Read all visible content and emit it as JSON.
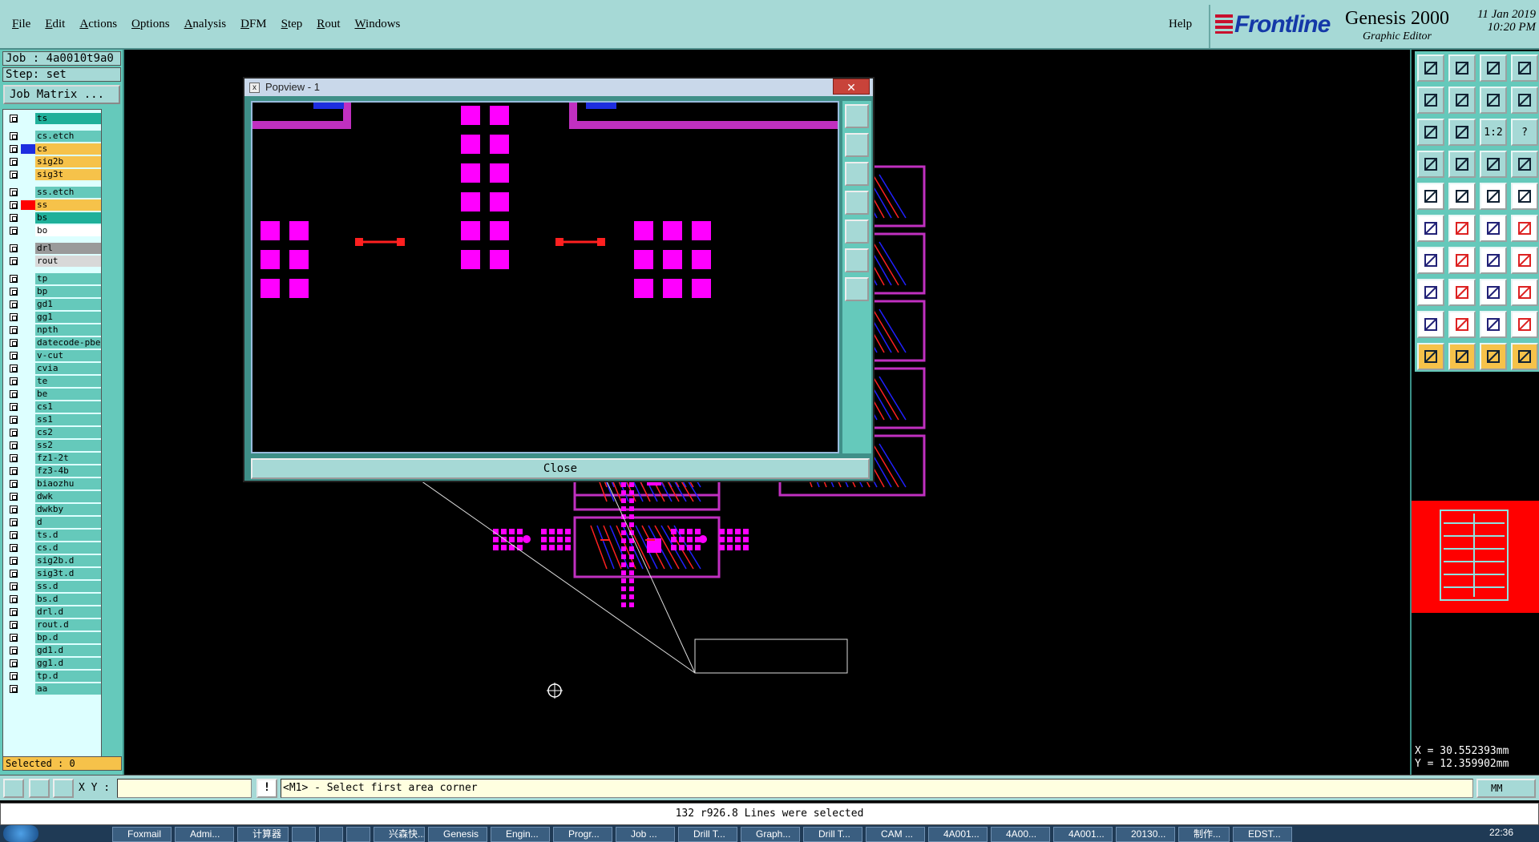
{
  "menubar": {
    "items": [
      "File",
      "Edit",
      "Actions",
      "Options",
      "Analysis",
      "DFM",
      "Step",
      "Rout",
      "Windows"
    ],
    "help": "Help",
    "brand": "Frontline",
    "product": "Genesis 2000",
    "subtitle": "Graphic Editor",
    "date": "11 Jan 2019",
    "time": "10:20 PM"
  },
  "left": {
    "job": "Job : 4a0010t9a0",
    "step": "Step: set",
    "matrix_button": "Job Matrix ...",
    "selected": "Selected : 0",
    "layers": [
      {
        "name": "ts",
        "color": "#1fb09a",
        "swatch": ""
      },
      {
        "name": "cs.etch",
        "color": "#65c9bb",
        "swatch": ""
      },
      {
        "name": "cs",
        "color": "#f6c24a",
        "swatch": "#1e2ee0"
      },
      {
        "name": "sig2b",
        "color": "#f6c24a",
        "swatch": ""
      },
      {
        "name": "sig3t",
        "color": "#f6c24a",
        "swatch": ""
      },
      {
        "name": "ss.etch",
        "color": "#65c9bb",
        "swatch": ""
      },
      {
        "name": "ss",
        "color": "#f6c24a",
        "swatch": "#ff0000"
      },
      {
        "name": "bs",
        "color": "#1fb09a",
        "swatch": ""
      },
      {
        "name": "bo",
        "color": "#ffffff",
        "swatch": ""
      },
      {
        "name": "drl",
        "color": "#9a9a9a",
        "swatch": ""
      },
      {
        "name": "rout",
        "color": "#d8d8d8",
        "swatch": ""
      },
      {
        "name": "tp",
        "color": "#65c9bb",
        "swatch": ""
      },
      {
        "name": "bp",
        "color": "#65c9bb",
        "swatch": ""
      },
      {
        "name": "gd1",
        "color": "#65c9bb",
        "swatch": ""
      },
      {
        "name": "gg1",
        "color": "#65c9bb",
        "swatch": ""
      },
      {
        "name": "npth",
        "color": "#65c9bb",
        "swatch": ""
      },
      {
        "name": "datecode-pbe",
        "color": "#65c9bb",
        "swatch": ""
      },
      {
        "name": "v-cut",
        "color": "#65c9bb",
        "swatch": ""
      },
      {
        "name": "cvia",
        "color": "#65c9bb",
        "swatch": ""
      },
      {
        "name": "te",
        "color": "#65c9bb",
        "swatch": ""
      },
      {
        "name": "be",
        "color": "#65c9bb",
        "swatch": ""
      },
      {
        "name": "cs1",
        "color": "#65c9bb",
        "swatch": ""
      },
      {
        "name": "ss1",
        "color": "#65c9bb",
        "swatch": ""
      },
      {
        "name": "cs2",
        "color": "#65c9bb",
        "swatch": ""
      },
      {
        "name": "ss2",
        "color": "#65c9bb",
        "swatch": ""
      },
      {
        "name": "fz1-2t",
        "color": "#65c9bb",
        "swatch": ""
      },
      {
        "name": "fz3-4b",
        "color": "#65c9bb",
        "swatch": ""
      },
      {
        "name": "biaozhu",
        "color": "#65c9bb",
        "swatch": ""
      },
      {
        "name": "dwk",
        "color": "#65c9bb",
        "swatch": ""
      },
      {
        "name": "dwkby",
        "color": "#65c9bb",
        "swatch": ""
      },
      {
        "name": "d",
        "color": "#65c9bb",
        "swatch": ""
      },
      {
        "name": "ts.d",
        "color": "#65c9bb",
        "swatch": ""
      },
      {
        "name": "cs.d",
        "color": "#65c9bb",
        "swatch": ""
      },
      {
        "name": "sig2b.d",
        "color": "#65c9bb",
        "swatch": ""
      },
      {
        "name": "sig3t.d",
        "color": "#65c9bb",
        "swatch": ""
      },
      {
        "name": "ss.d",
        "color": "#65c9bb",
        "swatch": ""
      },
      {
        "name": "bs.d",
        "color": "#65c9bb",
        "swatch": ""
      },
      {
        "name": "drl.d",
        "color": "#65c9bb",
        "swatch": ""
      },
      {
        "name": "rout.d",
        "color": "#65c9bb",
        "swatch": ""
      },
      {
        "name": "bp.d",
        "color": "#65c9bb",
        "swatch": ""
      },
      {
        "name": "gd1.d",
        "color": "#65c9bb",
        "swatch": ""
      },
      {
        "name": "gg1.d",
        "color": "#65c9bb",
        "swatch": ""
      },
      {
        "name": "tp.d",
        "color": "#65c9bb",
        "swatch": ""
      },
      {
        "name": "aa",
        "color": "#65c9bb",
        "swatch": ""
      }
    ]
  },
  "popview": {
    "title": "Popview - 1",
    "close_x": "✕",
    "close_button": "Close"
  },
  "toolbox": {
    "coord_x": "X = 30.552393mm",
    "coord_y": "Y = 12.359902mm",
    "ratio_label": "1:2",
    "help_label": "?"
  },
  "cmdbar": {
    "xy_label": "X Y :",
    "xy_value": "",
    "bang": "!",
    "prompt": "<M1> - Select first area corner",
    "units": "MM"
  },
  "status": "132 r926.8 Lines were selected",
  "taskbar": {
    "items": [
      "Foxmail",
      "Admi...",
      "计算器",
      "",
      "",
      "",
      "兴森快...",
      "Genesis",
      "Engin...",
      "Progr...",
      "Job ...",
      "Drill T...",
      "Graph...",
      "Drill T...",
      "CAM ...",
      "4A001...",
      "4A00...",
      "4A001...",
      "20130...",
      "制作...",
      "EDST..."
    ],
    "clock": "22:36"
  },
  "colors": {
    "pad": "#ff00ff",
    "trace_red": "#ff2020",
    "trace_blue": "#2020ff",
    "panel": "#a6d9d6"
  }
}
